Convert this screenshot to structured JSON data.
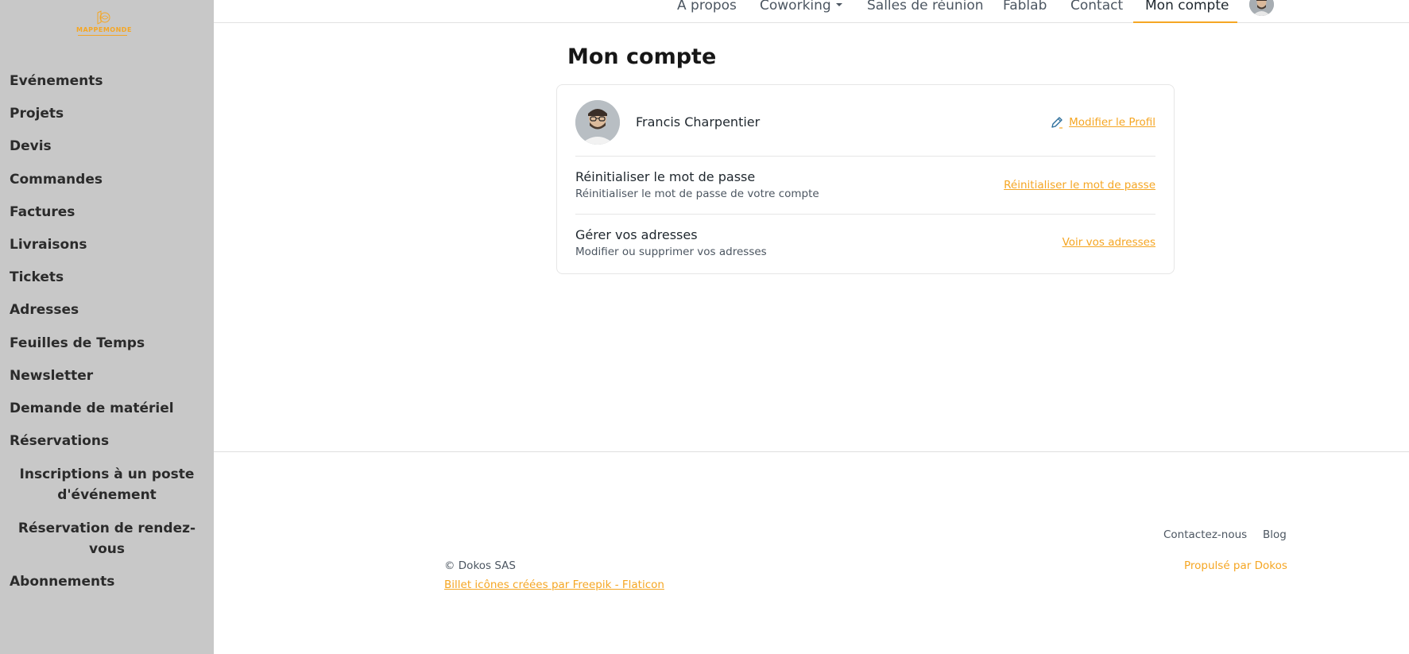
{
  "brand": {
    "name": "MAPPEMONDE",
    "accent_color": "#f5a623",
    "sidebar_bg": "#c8c8c8"
  },
  "sidebar": {
    "items": [
      {
        "label": "Evénements"
      },
      {
        "label": "Projets"
      },
      {
        "label": "Devis"
      },
      {
        "label": "Commandes"
      },
      {
        "label": "Factures"
      },
      {
        "label": "Livraisons"
      },
      {
        "label": "Tickets"
      },
      {
        "label": "Adresses"
      },
      {
        "label": "Feuilles de Temps"
      },
      {
        "label": "Newsletter"
      },
      {
        "label": "Demande de matériel"
      },
      {
        "label": "Réservations"
      }
    ],
    "sub_items": [
      {
        "label": "Inscriptions à un poste d'événement"
      },
      {
        "label": "Réservation de rendez-vous"
      }
    ],
    "last_item": {
      "label": "Abonnements"
    }
  },
  "topnav": {
    "links": [
      {
        "label": "À propos"
      },
      {
        "label": "Coworking"
      },
      {
        "label": "Salles de réunion"
      },
      {
        "label": "Fablab"
      },
      {
        "label": "Contact"
      },
      {
        "label": "Mon compte"
      }
    ],
    "active": "Mon compte",
    "avatar_icon": "user-avatar"
  },
  "page": {
    "title": "Mon compte"
  },
  "profile": {
    "name": "Francis Charpentier",
    "edit_label": "Modifier le Profil",
    "edit_icon": "pencil-icon"
  },
  "password": {
    "title": "Réinitialiser le mot de passe",
    "description": "Réinitialiser le mot de passe de votre compte",
    "action_label": "Réinitialiser le mot de passe"
  },
  "addresses": {
    "title": "Gérer vos adresses",
    "description": "Modifier ou supprimer vos adresses",
    "action_label": "Voir vos adresses"
  },
  "footer": {
    "links": [
      {
        "label": "Contactez-nous"
      },
      {
        "label": "Blog"
      }
    ],
    "copyright": "© Dokos SAS",
    "credits": "Billet icônes créées par Freepik - Flaticon",
    "powered_by": "Propulsé par Dokos"
  }
}
